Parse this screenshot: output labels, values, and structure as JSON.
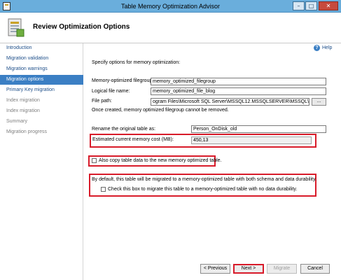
{
  "window": {
    "title": "Table Memory Optimization Advisor",
    "minimize_glyph": "–",
    "maximize_glyph": "□",
    "close_glyph": "✕"
  },
  "header": {
    "title": "Review Optimization Options"
  },
  "sidebar": {
    "items": [
      {
        "label": "Introduction",
        "state": "normal"
      },
      {
        "label": "Migration validation",
        "state": "normal"
      },
      {
        "label": "Migration warnings",
        "state": "normal"
      },
      {
        "label": "Migration options",
        "state": "active"
      },
      {
        "label": "Primary Key migration",
        "state": "normal"
      },
      {
        "label": "Index migration",
        "state": "disabled"
      },
      {
        "label": "Index migration",
        "state": "disabled"
      },
      {
        "label": "Summary",
        "state": "disabled"
      },
      {
        "label": "Migration progress",
        "state": "disabled"
      }
    ]
  },
  "main": {
    "help_label": "Help",
    "intro": "Specify options for memory optimization:",
    "filegroup_label": "Memory-optimized filegroup:",
    "filegroup_value": "memory_optimized_filegroup",
    "logical_label": "Logical file name:",
    "logical_value": "memory_optimized_file_blog",
    "path_label": "File path:",
    "path_value": "ogram Files\\Microsoft SQL Server\\MSSQL12.MSSQLSERVER\\MSSQL\\DATA",
    "browse_label": "...",
    "filegroup_note": "Once created, memory optimized filegroup cannot be removed.",
    "rename_label": "Rename the original table as:",
    "rename_value": "Person_OnDisk_old",
    "memory_cost_label": "Estimated current memory cost (MB):",
    "memory_cost_value": "450,13",
    "copy_data_label": "Also copy table data to the new memory optimized table.",
    "durability_note": "By default, this table will be migrated to a memory-optimized table with both schema and data durability.",
    "no_durability_label": "Check this box to migrate this table to a memory-optimized table with no data durability."
  },
  "buttons": {
    "previous": "< Previous",
    "next": "Next >",
    "migrate": "Migrate",
    "cancel": "Cancel"
  },
  "colors": {
    "titlebar": "#6aaedc",
    "active_nav": "#3b7fc4",
    "highlight": "#d81b2a",
    "link": "#1d4e89"
  }
}
